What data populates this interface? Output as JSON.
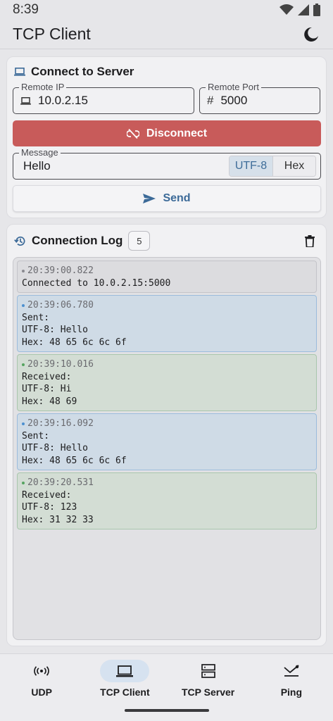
{
  "status_bar": {
    "time": "8:39"
  },
  "app_bar": {
    "title": "TCP Client",
    "theme_icon": "moon-icon"
  },
  "connect_card": {
    "title": "Connect to Server",
    "remote_ip": {
      "label": "Remote IP",
      "value": "10.0.2.15"
    },
    "remote_port": {
      "label": "Remote Port",
      "value": "5000"
    },
    "disconnect_label": "Disconnect",
    "message": {
      "label": "Message",
      "value": "Hello"
    },
    "encoding": {
      "options": [
        "UTF-8",
        "Hex"
      ],
      "selected": "UTF-8"
    },
    "send_label": "Send"
  },
  "log_card": {
    "title": "Connection Log",
    "count": "5",
    "entries": [
      {
        "type": "system",
        "time": "20:39:00.822",
        "lines": [
          "Connected to 10.0.2.15:5000"
        ]
      },
      {
        "type": "sent",
        "time": "20:39:06.780",
        "lines": [
          "Sent:",
          "UTF-8: Hello",
          "Hex: 48 65 6c 6c 6f"
        ]
      },
      {
        "type": "received",
        "time": "20:39:10.016",
        "lines": [
          "Received:",
          "UTF-8: Hi",
          "Hex: 48 69"
        ]
      },
      {
        "type": "sent",
        "time": "20:39:16.092",
        "lines": [
          "Sent:",
          "UTF-8: Hello",
          "Hex: 48 65 6c 6c 6f"
        ]
      },
      {
        "type": "received",
        "time": "20:39:20.531",
        "lines": [
          "Received:",
          "UTF-8: 123",
          "Hex: 31 32 33"
        ]
      }
    ]
  },
  "bottom_nav": {
    "items": [
      {
        "label": "UDP",
        "icon": "broadcast-icon",
        "active": false
      },
      {
        "label": "TCP Client",
        "icon": "laptop-icon",
        "active": true
      },
      {
        "label": "TCP Server",
        "icon": "server-icon",
        "active": false
      },
      {
        "label": "Ping",
        "icon": "ping-icon",
        "active": false
      }
    ]
  },
  "colors": {
    "accent": "#3c6a98",
    "danger": "#c85b5a",
    "sent": "#cfdbe6",
    "received": "#d3ddd4"
  }
}
